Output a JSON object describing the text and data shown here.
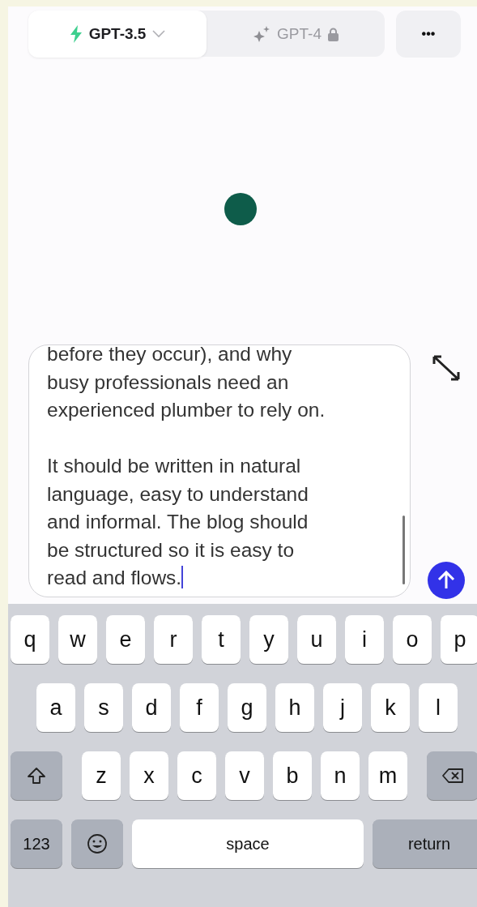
{
  "toolbar": {
    "models": [
      {
        "label": "GPT-3.5",
        "selected": true,
        "kind": "bolt",
        "dropdown": true,
        "locked": false
      },
      {
        "label": "GPT-4",
        "selected": false,
        "kind": "sparkle",
        "dropdown": false,
        "locked": true
      }
    ],
    "more": "•••"
  },
  "composer": {
    "paragraphs": [
      {
        "lines": [
          "before they occur), and why",
          "busy professionals need an",
          "experienced plumber to rely on."
        ]
      },
      {
        "lines": [
          "It should be written in natural",
          "language, easy to understand",
          "and informal. The blog should",
          "be structured so it is easy to",
          "read and flows."
        ]
      }
    ]
  },
  "keyboard": {
    "rows": [
      {
        "keys": [
          {
            "kind": "letter",
            "label": "q"
          },
          {
            "kind": "letter",
            "label": "w"
          },
          {
            "kind": "letter",
            "label": "e"
          },
          {
            "kind": "letter",
            "label": "r"
          },
          {
            "kind": "letter",
            "label": "t"
          },
          {
            "kind": "letter",
            "label": "y"
          },
          {
            "kind": "letter",
            "label": "u"
          },
          {
            "kind": "letter",
            "label": "i"
          },
          {
            "kind": "letter",
            "label": "o"
          },
          {
            "kind": "letter",
            "label": "p"
          }
        ]
      },
      {
        "keys": [
          {
            "kind": "letter",
            "label": "a"
          },
          {
            "kind": "letter",
            "label": "s"
          },
          {
            "kind": "letter",
            "label": "d"
          },
          {
            "kind": "letter",
            "label": "f"
          },
          {
            "kind": "letter",
            "label": "g"
          },
          {
            "kind": "letter",
            "label": "h"
          },
          {
            "kind": "letter",
            "label": "j"
          },
          {
            "kind": "letter",
            "label": "k"
          },
          {
            "kind": "letter",
            "label": "l"
          }
        ]
      },
      {
        "keys": [
          {
            "kind": "shift"
          },
          {
            "kind": "letter",
            "label": "z"
          },
          {
            "kind": "letter",
            "label": "x"
          },
          {
            "kind": "letter",
            "label": "c"
          },
          {
            "kind": "letter",
            "label": "v"
          },
          {
            "kind": "letter",
            "label": "b"
          },
          {
            "kind": "letter",
            "label": "n"
          },
          {
            "kind": "letter",
            "label": "m"
          },
          {
            "kind": "backspace"
          }
        ]
      },
      {
        "keys": [
          {
            "kind": "mode",
            "label": "123"
          },
          {
            "kind": "emoji"
          },
          {
            "kind": "space",
            "label": "space"
          },
          {
            "kind": "return",
            "label": "return"
          }
        ]
      }
    ]
  }
}
